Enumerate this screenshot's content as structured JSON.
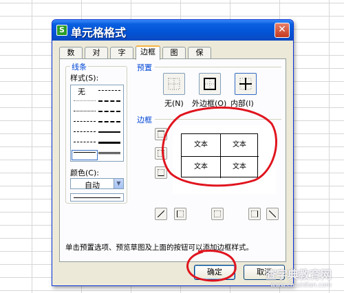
{
  "dialog": {
    "title": "单元格格式",
    "app_icon": "S",
    "close_label": "✕"
  },
  "tabs": [
    {
      "label": "数字"
    },
    {
      "label": "对齐"
    },
    {
      "label": "字体"
    },
    {
      "label": "边框",
      "active": true
    },
    {
      "label": "图案"
    },
    {
      "label": "保护"
    }
  ],
  "line": {
    "legend": "线条",
    "style_label": "样式(S):",
    "none_label": "无",
    "color_label": "颜色(C):",
    "color_value": "自动"
  },
  "preset": {
    "title": "预置",
    "items": [
      {
        "label": "无(N)"
      },
      {
        "label": "外边框(O)"
      },
      {
        "label": "内部(I)"
      }
    ]
  },
  "border": {
    "title": "边框",
    "preview_cells": [
      "文本",
      "文本",
      "文本",
      "文本"
    ]
  },
  "hint": "单击预置选项、预览草图及上面的按钮可以添加边框样式。",
  "buttons": {
    "ok": "确定",
    "cancel": "取消"
  },
  "watermark": {
    "main": "查字典教育网",
    "sub": "www.chazidian.com"
  },
  "colors": {
    "annotation_red": "#e0141e",
    "title_blue": "#0354d6",
    "group_title_blue": "#0046d5"
  }
}
